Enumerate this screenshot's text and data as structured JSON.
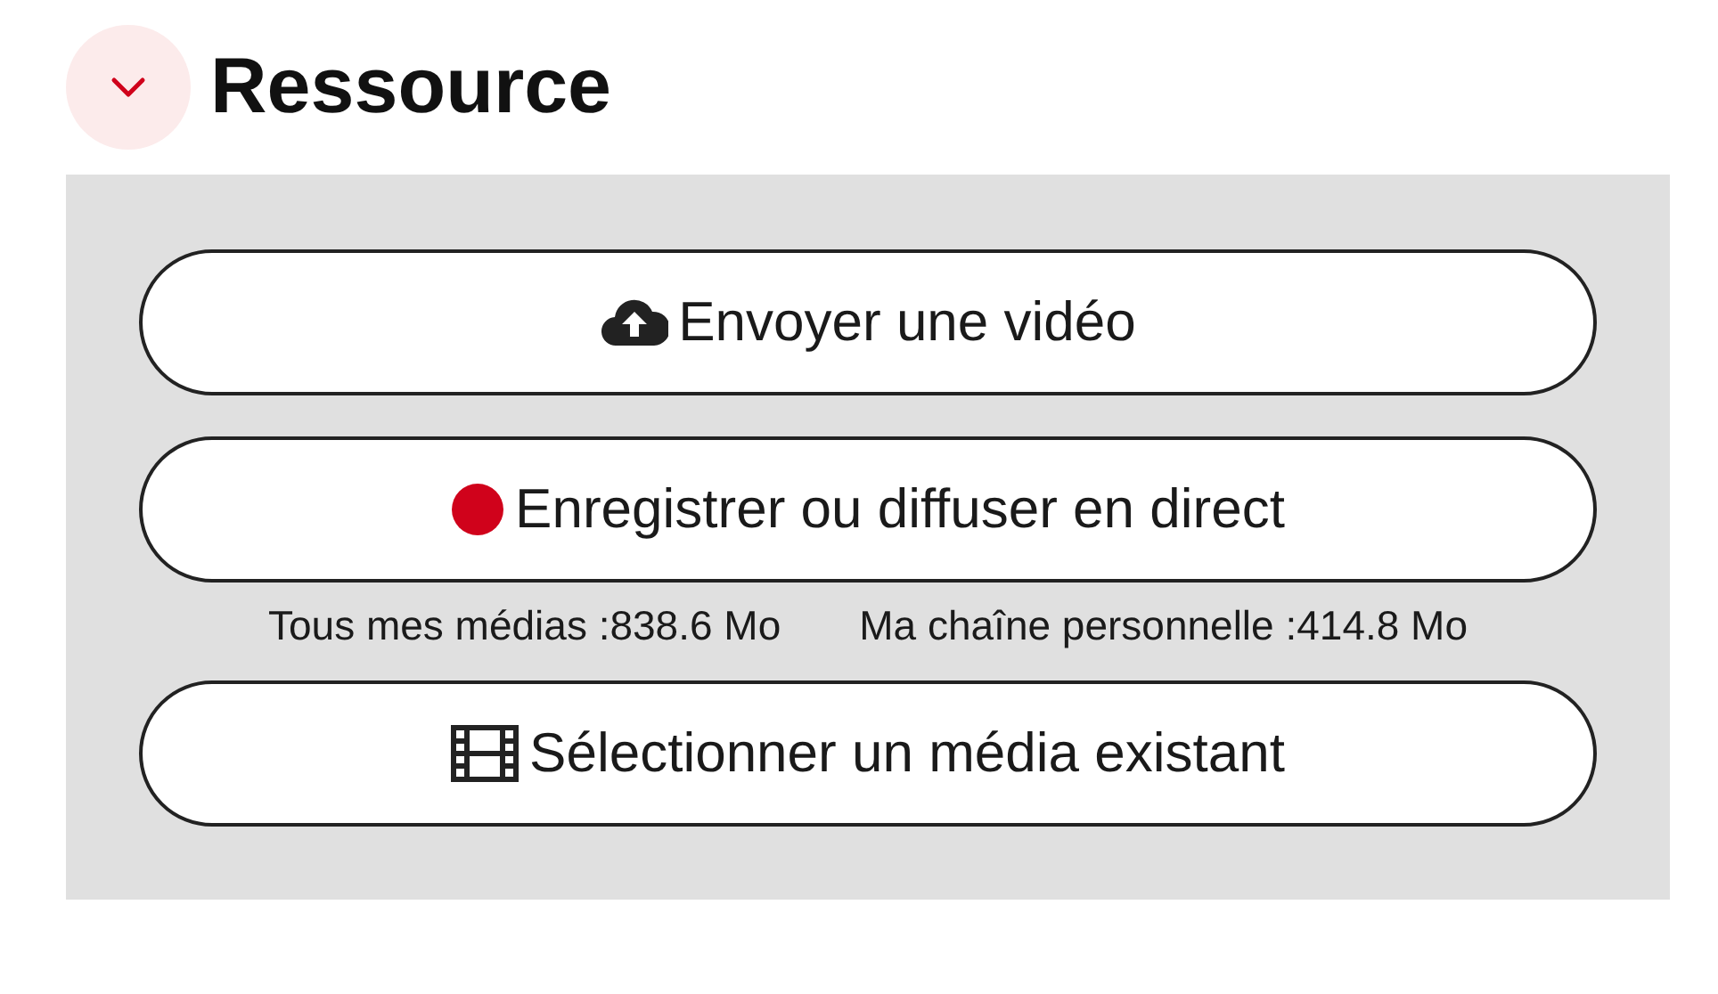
{
  "section": {
    "title": "Ressource",
    "expanded": true
  },
  "actions": [
    {
      "kind": "upload",
      "label": "Envoyer une vidéo"
    },
    {
      "kind": "record",
      "label": "Enregistrer ou diffuser en direct"
    }
  ],
  "storage": [
    "Tous mes médias :838.6 Mo",
    "Ma chaîne personnelle :414.8 Mo"
  ],
  "more_actions": [
    {
      "kind": "film",
      "label": "Sélectionner un média existant"
    }
  ]
}
